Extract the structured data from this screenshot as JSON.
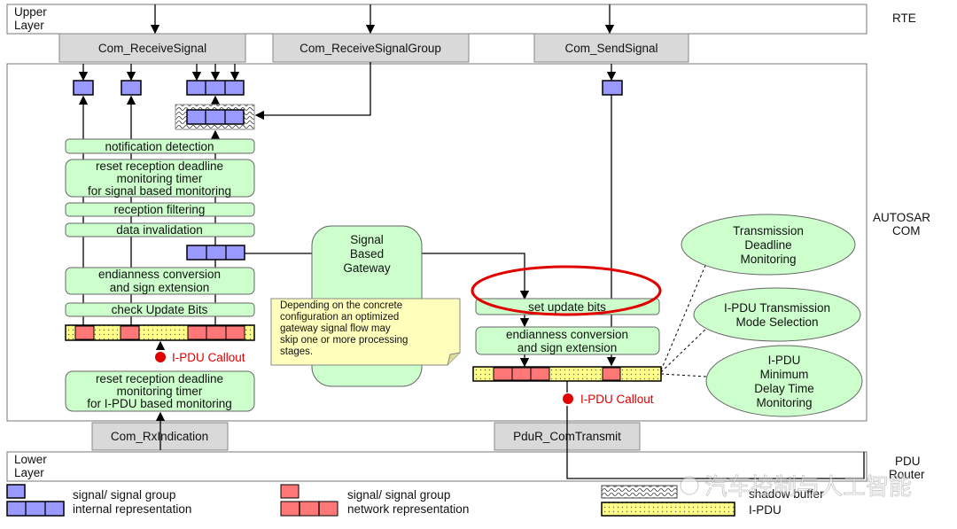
{
  "layers": {
    "upper": [
      "Upper",
      "Layer"
    ],
    "rte": "RTE",
    "com": [
      "AUTOSAR",
      "COM"
    ],
    "lower": [
      "Lower",
      "Layer"
    ],
    "pdur": [
      "PDU",
      "Router"
    ]
  },
  "apis": {
    "receive_signal": "Com_ReceiveSignal",
    "receive_signal_group": "Com_ReceiveSignalGroup",
    "send_signal": "Com_SendSignal",
    "rx_indication": "Com_RxIndication",
    "transmit": "PduR_ComTransmit"
  },
  "rx_steps": {
    "notification": "notification detection",
    "reset_signal": [
      "reset reception deadline",
      "monitoring timer",
      "for signal based monitoring"
    ],
    "filtering": "reception filtering",
    "invalidation": "data invalidation",
    "endianness": [
      "endianness conversion",
      "and sign extension"
    ],
    "check_update": "check Update Bits",
    "reset_ipdu": [
      "reset reception deadline",
      "monitoring timer",
      "for I-PDU based monitoring"
    ]
  },
  "gateway": {
    "title": [
      "Signal",
      "Based",
      "Gateway"
    ],
    "note": [
      "Depending on the concrete",
      "configuration an optimized",
      "gateway signal flow may",
      "skip one or more processing",
      "stages."
    ]
  },
  "tx_steps": {
    "set_update": "set update bits",
    "endianness": [
      "endianness conversion",
      "and sign extension"
    ]
  },
  "callout": "I-PDU Callout",
  "tx_options": [
    [
      "Transmission",
      "Deadline",
      "Monitoring"
    ],
    [
      "I-PDU Transmission",
      "Mode Selection"
    ],
    [
      "I-PDU",
      "Minimum",
      "Delay Time",
      "Monitoring"
    ]
  ],
  "legend": {
    "internal": [
      "signal/ signal group",
      "internal representation"
    ],
    "network": [
      "signal/ signal group",
      "network representation"
    ],
    "shadow": "shadow buffer",
    "ipdu": "I-PDU"
  },
  "watermark": "汽车控制与人工智能",
  "colors": {
    "internal": "#9999ff",
    "network": "#ff7777",
    "step": "#ccffcc",
    "ipdu": "#ffff88",
    "highlight": "#e00000"
  }
}
